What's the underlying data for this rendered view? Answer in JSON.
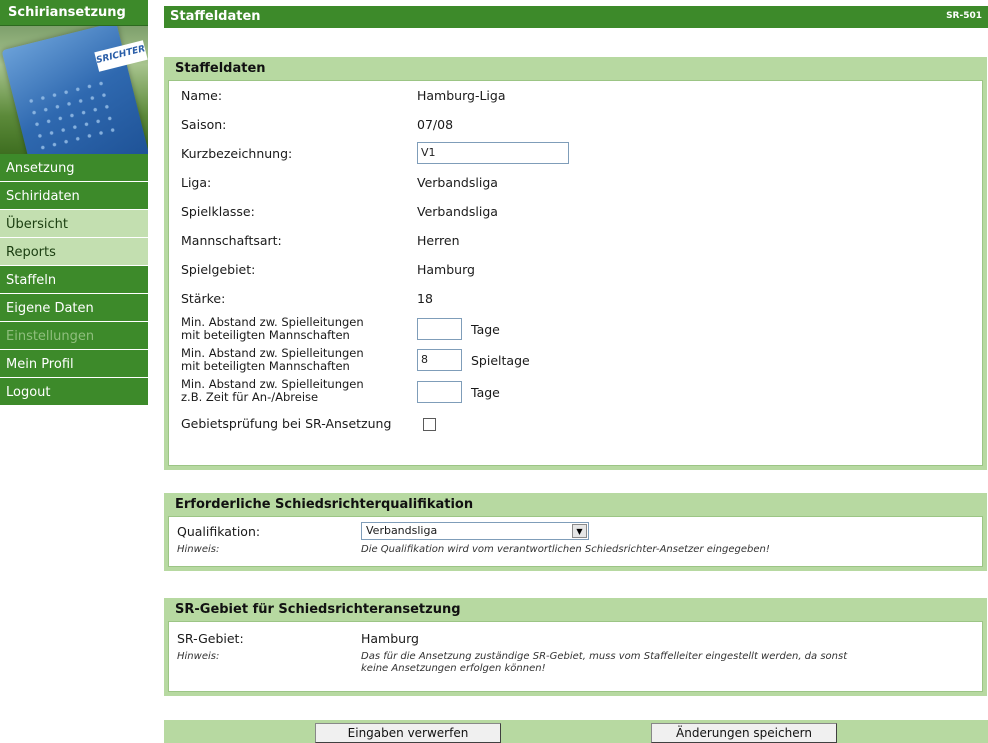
{
  "sidebar": {
    "title": "Schiriansetzung",
    "badge_text": "SRICHTER",
    "items": [
      {
        "label": "Ansetzung"
      },
      {
        "label": "Schiridaten"
      },
      {
        "label": "Übersicht"
      },
      {
        "label": "Reports"
      },
      {
        "label": "Staffeln"
      },
      {
        "label": "Eigene Daten"
      },
      {
        "label": "Einstellungen"
      },
      {
        "label": "Mein Profil"
      },
      {
        "label": "Logout"
      }
    ]
  },
  "header": {
    "title": "Staffeldaten",
    "code": "SR-501"
  },
  "staffel": {
    "title": "Staffeldaten",
    "name_label": "Name:",
    "name_value": "Hamburg-Liga",
    "saison_label": "Saison:",
    "saison_value": "07/08",
    "kurz_label": "Kurzbezeichnung:",
    "kurz_value": "V1",
    "liga_label": "Liga:",
    "liga_value": "Verbandsliga",
    "spielklasse_label": "Spielklasse:",
    "spielklasse_value": "Verbandsliga",
    "mannschaftsart_label": "Mannschaftsart:",
    "mannschaftsart_value": "Herren",
    "spielgebiet_label": "Spielgebiet:",
    "spielgebiet_value": "Hamburg",
    "staerke_label": "Stärke:",
    "staerke_value": "18",
    "abstand1_label_l1": "Min. Abstand zw. Spielleitungen",
    "abstand1_label_l2": "mit beteiligten Mannschaften",
    "abstand1_value": "",
    "abstand1_unit": "Tage",
    "abstand2_label_l1": "Min. Abstand zw. Spielleitungen",
    "abstand2_label_l2": "mit beteiligten Mannschaften",
    "abstand2_value": "8",
    "abstand2_unit": "Spieltage",
    "abstand3_label_l1": "Min. Abstand zw. Spielleitungen",
    "abstand3_label_l2": "z.B. Zeit für An-/Abreise",
    "abstand3_value": "",
    "abstand3_unit": "Tage",
    "gebiet_label": "Gebietsprüfung bei SR-Ansetzung"
  },
  "qualifikation": {
    "title": "Erforderliche Schiedsrichterqualifikation",
    "label": "Qualifikation:",
    "selected": "Verbandsliga",
    "hint_label": "Hinweis:",
    "hint_text": "Die Qualifikation wird vom verantwortlichen Schiedsrichter-Ansetzer eingegeben!"
  },
  "srgebiet": {
    "title": "SR-Gebiet für Schiedsrichteransetzung",
    "label": "SR-Gebiet:",
    "value": "Hamburg",
    "hint_label": "Hinweis:",
    "hint_line1": "Das für die Ansetzung zuständige SR-Gebiet, muss vom Staffelleiter eingestellt werden, da sonst",
    "hint_line2": "keine Ansetzungen erfolgen können!"
  },
  "footer": {
    "discard_label": "Eingaben verwerfen",
    "save_label": "Änderungen speichern"
  }
}
